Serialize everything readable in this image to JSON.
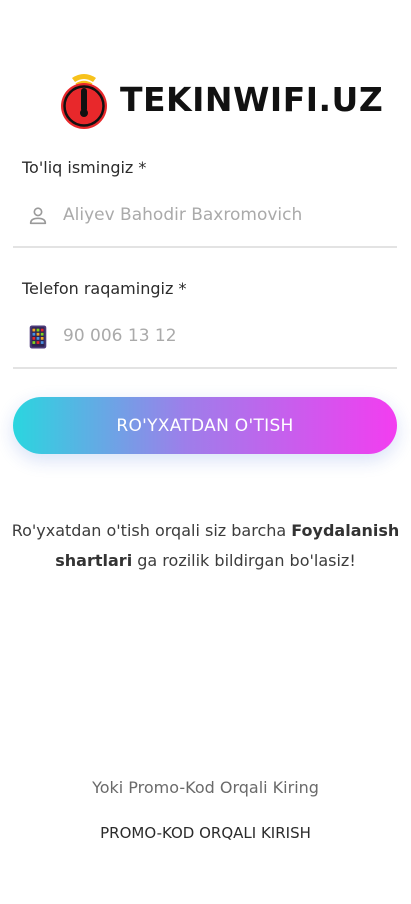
{
  "logo": {
    "text": "TEKINWIFI.UZ",
    "icon": "wifi-pin-icon",
    "colors": {
      "red": "#e8282b",
      "yellow": "#f7c21b",
      "black": "#111111"
    }
  },
  "form": {
    "name_field": {
      "label": "To'liq ismingiz *",
      "placeholder": "Aliyev Bahodir Baxromovich",
      "value": "",
      "icon": "person-icon"
    },
    "phone_field": {
      "label": "Telefon raqamingiz *",
      "placeholder": "90 006 13 12",
      "value": "",
      "icon": "phone-keypad-icon"
    },
    "register_button": {
      "label": "RO'YXATDAN O'TISH",
      "gradient": [
        "#2ad6df",
        "#f33df0"
      ]
    }
  },
  "terms": {
    "prefix": "Ro'yxatdan o'tish orqali siz barcha ",
    "link": "Foydalanish shartlari",
    "suffix": " ga rozilik bildirgan bo'lasiz!"
  },
  "promo": {
    "hint": "Yoki Promo-Kod Orqali Kiring",
    "button_label": "PROMO-KOD ORQALI KIRISH"
  }
}
